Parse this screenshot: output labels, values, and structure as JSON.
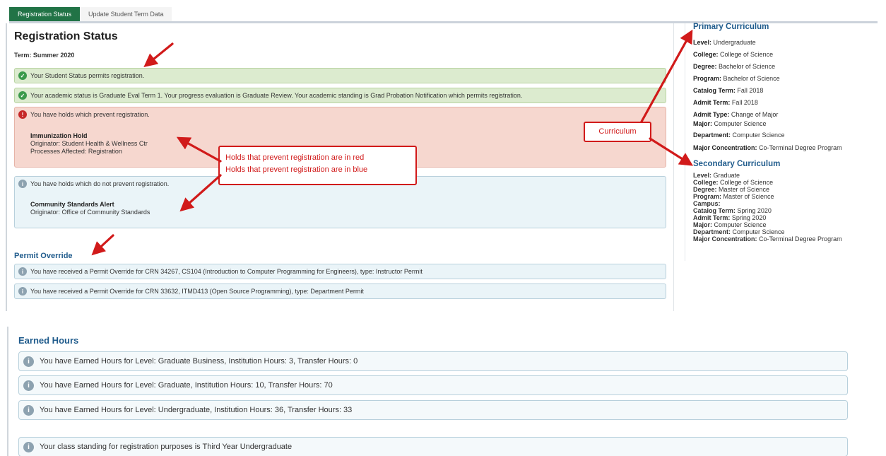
{
  "tabs": [
    {
      "label": "Registration Status"
    },
    {
      "label": "Update Student Term Data"
    }
  ],
  "registration": {
    "title": "Registration Status",
    "term": "Term: Summer 2020",
    "student_status": "Your Student Status permits registration.",
    "academic_status": "Your academic status is Graduate Eval Term 1. Your progress evaluation is Graduate Review. Your academic standing is Grad Probation Notification which permits registration.",
    "prevent_holds": {
      "message": "You have holds which prevent registration.",
      "hold_title": "Immunization Hold",
      "originator": "Originator: Student Health & Wellness Ctr",
      "processes": "Processes Affected: Registration"
    },
    "nonprevent_holds": {
      "message": "You have holds which do not prevent registration.",
      "hold_title": "Community Standards Alert",
      "originator": "Originator: Office of Community Standards"
    }
  },
  "permit_override": {
    "title": "Permit Override",
    "items": [
      "You have received a Permit Override for CRN 34267, CS104 (Introduction to Computer Programming for Engineers), type: Instructor Permit",
      "You have received a Permit Override for CRN 33632, ITMD413 (Open Source Programming), type: Department Permit"
    ]
  },
  "primary_curriculum": {
    "title": "Primary Curriculum",
    "fields": [
      {
        "label": "Level:",
        "value": "Undergraduate"
      },
      {
        "label": "College:",
        "value": "College of Science"
      },
      {
        "label": "Degree:",
        "value": "Bachelor of Science"
      },
      {
        "label": "Program:",
        "value": "Bachelor of Science"
      },
      {
        "label": "Catalog Term:",
        "value": "Fall 2018"
      },
      {
        "label": "Admit Term:",
        "value": "Fall 2018"
      },
      {
        "label": "Admit Type:",
        "value": "Change of Major"
      },
      {
        "label": "Major:",
        "value": "Computer Science"
      },
      {
        "label": "Department:",
        "value": "Computer Science"
      },
      {
        "label": "Major Concentration:",
        "value": "Co-Terminal Degree Program"
      }
    ]
  },
  "secondary_curriculum": {
    "title": "Secondary Curriculum",
    "fields": [
      {
        "label": "Level:",
        "value": "Graduate"
      },
      {
        "label": "College:",
        "value": "College of Science"
      },
      {
        "label": "Degree:",
        "value": "Master of Science"
      },
      {
        "label": "Program:",
        "value": "Master of Science"
      },
      {
        "label": "Campus:",
        "value": ""
      },
      {
        "label": "Catalog Term:",
        "value": "Spring 2020"
      },
      {
        "label": "Admit Term:",
        "value": "Spring 2020"
      },
      {
        "label": "Major:",
        "value": "Computer Science"
      },
      {
        "label": "Department:",
        "value": "Computer Science"
      },
      {
        "label": "Major Concentration:",
        "value": "Co-Terminal Degree Program"
      }
    ]
  },
  "callouts": {
    "holds_line1": "Holds that prevent registration are in red",
    "holds_line2": "Holds that prevent registration are in blue",
    "curriculum": "Curriculum"
  },
  "earned_hours": {
    "title": "Earned Hours",
    "items": [
      "You have Earned Hours for Level: Graduate Business, Institution Hours: 3, Transfer Hours: 0",
      "You have Earned Hours for Level: Graduate, Institution Hours: 10, Transfer Hours: 70",
      "You have Earned Hours for Level: Undergraduate, Institution Hours: 36, Transfer Hours: 33"
    ],
    "class_standing": "Your class standing for registration purposes is Third Year Undergraduate"
  },
  "colors": {
    "accent_green": "#217346",
    "heading_blue": "#1f5b8c",
    "annotation_red": "#d11a1a"
  }
}
